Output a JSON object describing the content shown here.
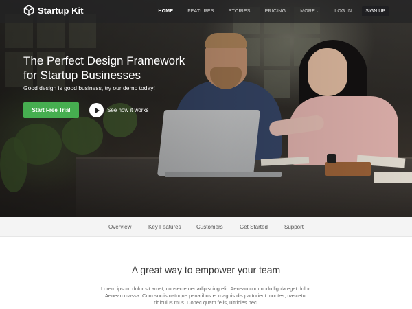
{
  "brand": {
    "name": "Startup Kit",
    "icon": "cube-icon"
  },
  "nav": {
    "links": [
      {
        "label": "HOME",
        "active": true
      },
      {
        "label": "FEATURES",
        "active": false
      },
      {
        "label": "STORIES",
        "active": false
      },
      {
        "label": "PRICING",
        "active": false
      },
      {
        "label": "MORE",
        "active": false,
        "caret": "⌄"
      },
      {
        "label": "LOG IN",
        "active": false
      }
    ],
    "signup_label": "SIGN UP"
  },
  "hero": {
    "title_line1": "The Perfect Design Framework",
    "title_line2": "for Startup Businesses",
    "subtitle": "Good design is good business, try our demo today!",
    "cta_label": "Start Free Trial",
    "video_label": "See how it works"
  },
  "subnav": {
    "items": [
      "Overview",
      "Key Features",
      "Customers",
      "Get Started",
      "Support"
    ]
  },
  "section": {
    "title": "A great way to empower your team",
    "body_line1": "Lorem ipsum dolor sit amet, consectetuer adipiscing elit. Aenean commodo ligula eget dolor.",
    "body_line2": "Aenean massa. Cum sociis natoque penatibus et magnis dis parturient montes, nascetur",
    "body_line3": "ridiculus mus. Donec quam felis, ultricies nec."
  },
  "colors": {
    "cta_green": "#46ae50",
    "navbar_bg": "#222224",
    "subnav_bg": "#f4f4f4"
  }
}
